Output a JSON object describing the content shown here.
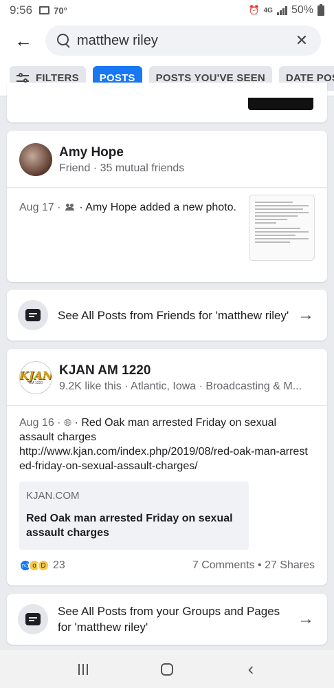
{
  "status": {
    "time": "9:56",
    "temperature": "70°",
    "network": "4G",
    "battery": "50%"
  },
  "search": {
    "query": "matthew riley"
  },
  "filters": [
    {
      "label": "FILTERS"
    },
    {
      "label": "POSTS",
      "active": true
    },
    {
      "label": "POSTS YOU'VE SEEN"
    },
    {
      "label": "DATE POSTED"
    }
  ],
  "amy_result": {
    "name": "Amy Hope",
    "subtitle": "Friend · 35 mutual friends",
    "post_date": "Aug 17 ·",
    "post_text": "· Amy Hope added a new photo."
  },
  "see_friends": {
    "label": "See All Posts from Friends for 'matthew riley'"
  },
  "kjan_result": {
    "name": "KJAN AM 1220",
    "subtitle": "9.2K like this · Atlantic, Iowa · Broadcasting & M...",
    "logo_text": "KJAN",
    "logo_sub": "AM 1220",
    "post_date": "Aug 16 ·",
    "post_text": "· Red Oak man arrested Friday on sexual assault charges",
    "post_link": "http://www.kjan.com/index.php/2019/08/red-oak-man-arrested-friday-on-sexual-assault-charges/",
    "link_domain": "KJAN.COM",
    "link_title": "Red Oak man arrested Friday on sexual assault charges",
    "reaction_count": "23",
    "engagement": "7 Comments • 27 Shares"
  },
  "see_groups": {
    "label": "See All Posts from your Groups and Pages for 'matthew riley'"
  },
  "colors": {
    "accent": "#1877f2",
    "background": "#e9ebee"
  }
}
